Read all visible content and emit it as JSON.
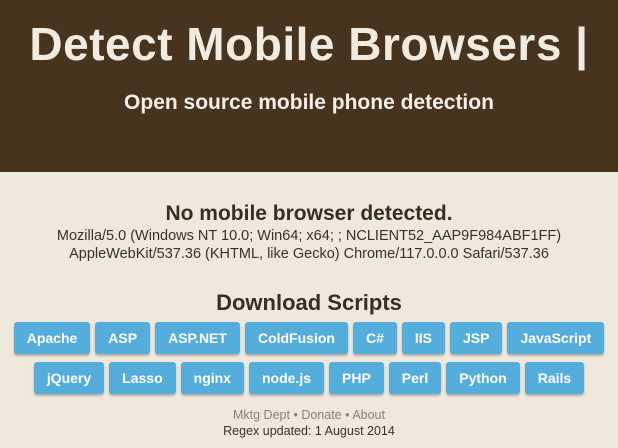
{
  "header": {
    "title": "Detect Mobile Browsers |",
    "subtitle": "Open source mobile phone detection"
  },
  "detection": {
    "title": "No mobile browser detected.",
    "user_agent_line1": "Mozilla/5.0 (Windows NT 10.0; Win64; x64; ; NCLIENT52_AAP9F984ABF1FF)",
    "user_agent_line2": "AppleWebKit/537.36 (KHTML, like Gecko) Chrome/117.0.0.0 Safari/537.36"
  },
  "downloads": {
    "title": "Download Scripts",
    "row1": [
      "Apache",
      "ASP",
      "ASP.NET",
      "ColdFusion",
      "C#",
      "IIS",
      "JSP",
      "JavaScript"
    ],
    "row2": [
      "jQuery",
      "Lasso",
      "nginx",
      "node.js",
      "PHP",
      "Perl",
      "Python",
      "Rails"
    ]
  },
  "footer": {
    "link_mktg": "Mktg Dept",
    "link_donate": "Donate",
    "link_about": "About",
    "separator": "•",
    "updated": "Regex updated: 1 August 2014"
  },
  "colors": {
    "header_bg": "#47341f",
    "page_bg": "#efe9dd",
    "button_bg": "#55addc"
  }
}
